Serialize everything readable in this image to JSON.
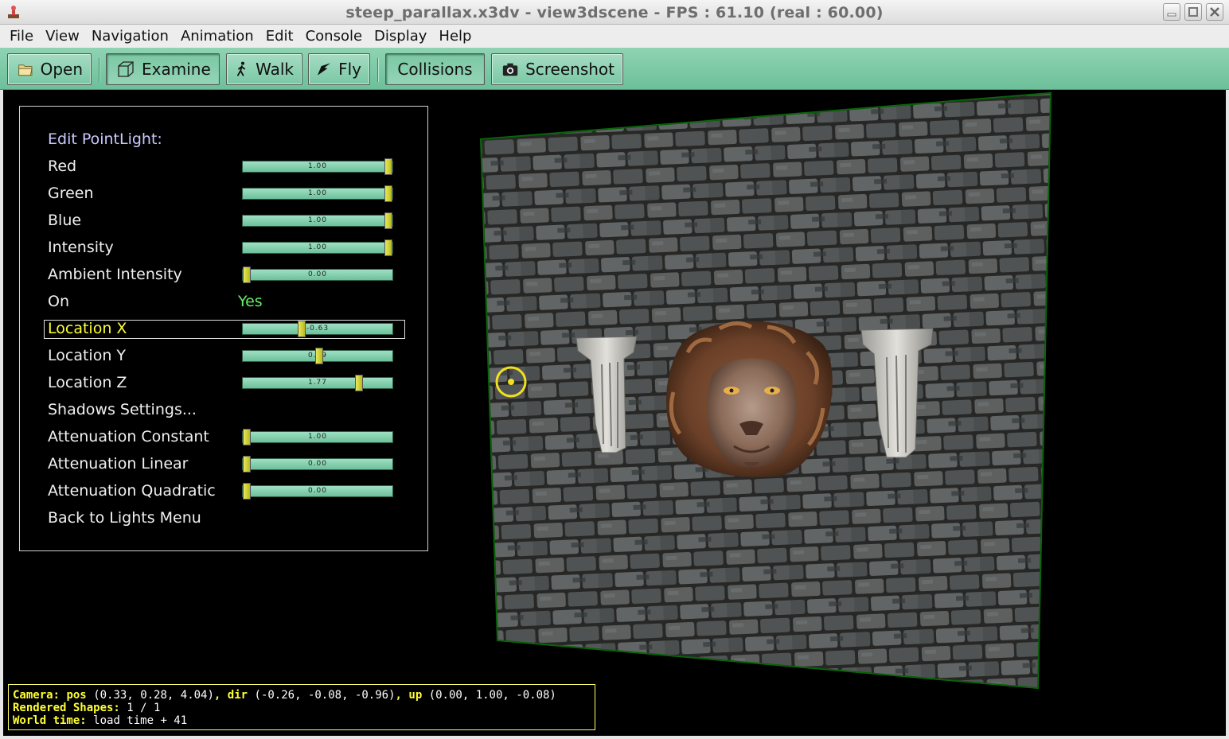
{
  "window": {
    "title": "steep_parallax.x3dv - view3dscene - FPS : 61.10 (real : 60.00)",
    "app_icon": "view3dscene-icon",
    "buttons": [
      "minimize-icon",
      "maximize-icon",
      "close-icon"
    ]
  },
  "menu": [
    "File",
    "View",
    "Navigation",
    "Animation",
    "Edit",
    "Console",
    "Display",
    "Help"
  ],
  "toolbar": {
    "open": "Open",
    "examine": "Examine",
    "walk": "Walk",
    "fly": "Fly",
    "collisions": "Collisions",
    "screenshot": "Screenshot",
    "accent": "#7ac8a5"
  },
  "panel": {
    "title": "Edit PointLight:",
    "rows": [
      {
        "label": "Red",
        "value": "1.00",
        "fraction": 1.0
      },
      {
        "label": "Green",
        "value": "1.00",
        "fraction": 1.0
      },
      {
        "label": "Blue",
        "value": "1.00",
        "fraction": 1.0
      },
      {
        "label": "Intensity",
        "value": "1.00",
        "fraction": 1.0
      },
      {
        "label": "Ambient Intensity",
        "value": "0.00",
        "fraction": 0.0
      },
      {
        "label": "On",
        "value": "Yes"
      },
      {
        "label": "Location X",
        "value": "-0.63",
        "fraction": 0.39,
        "selected": true
      },
      {
        "label": "Location Y",
        "value": "0.09",
        "fraction": 0.51
      },
      {
        "label": "Location Z",
        "value": "1.77",
        "fraction": 0.79
      },
      {
        "label": "Shadows Settings..."
      },
      {
        "label": "Attenuation Constant",
        "value": "1.00",
        "fraction": 0.0
      },
      {
        "label": "Attenuation Linear",
        "value": "0.00",
        "fraction": 0.0
      },
      {
        "label": "Attenuation Quadratic",
        "value": "0.00",
        "fraction": 0.0
      },
      {
        "label": "Back to Lights Menu"
      }
    ]
  },
  "status": {
    "camera_key": "Camera:",
    "pos_key": "pos",
    "pos_val": "(0.33, 0.28, 4.04)",
    "dir_key": "dir",
    "dir_val": "(-0.26, -0.08, -0.96)",
    "up_key": "up",
    "up_val": "(0.00, 1.00, -0.08)",
    "shapes_key": "Rendered Shapes:",
    "shapes_val": "1 / 1",
    "time_key": "World time:",
    "time_val": "load time + 41"
  }
}
